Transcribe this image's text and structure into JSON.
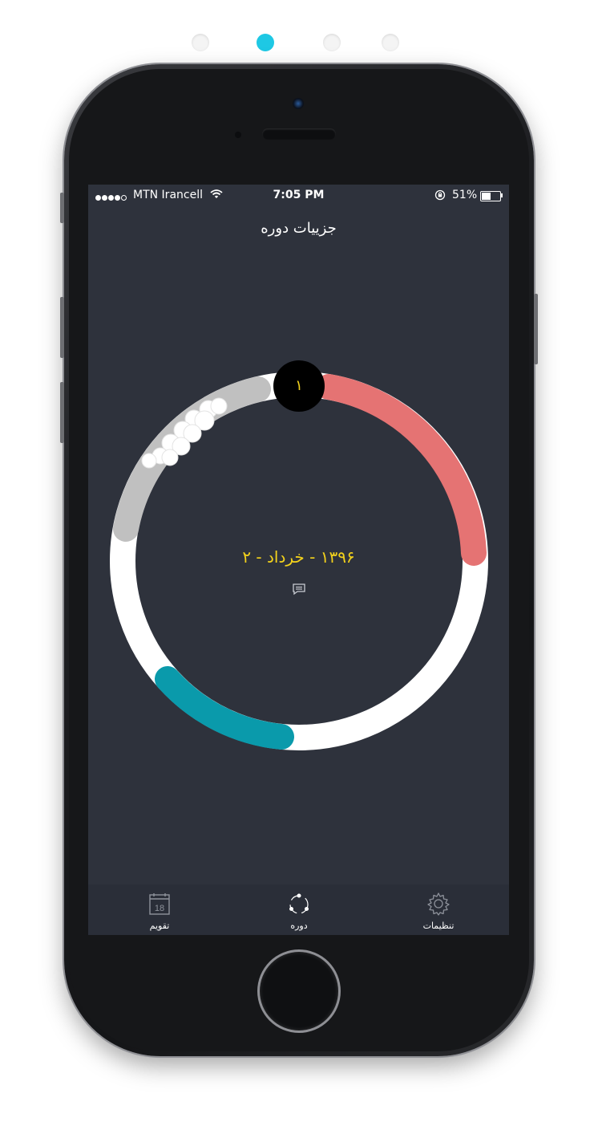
{
  "pager": {
    "count": 4,
    "active": 1,
    "active_color": "#1ec8e4"
  },
  "status_bar": {
    "carrier": "MTN Irancell",
    "time": "7:05 PM",
    "battery": "51%",
    "battery_level": 0.51
  },
  "nav": {
    "title": "جزییات دوره"
  },
  "cycle": {
    "day": "۱",
    "date_label": "۱۳۹۶ - خرداد - ۲",
    "colors": {
      "ring": "#ffffff",
      "period": "#e57373",
      "fertile": "#0a9aab",
      "pms": "#c0c0c0",
      "accent_text": "#f3d21c"
    },
    "icons": {
      "note": "chat-icon",
      "clouds": "cloud-icon"
    }
  },
  "tabs": [
    {
      "label": "تقویم",
      "icon": "calendar-icon",
      "day": "18"
    },
    {
      "label": "دوره",
      "icon": "cycle-icon"
    },
    {
      "label": "تنظیمات",
      "icon": "gear-icon"
    }
  ]
}
